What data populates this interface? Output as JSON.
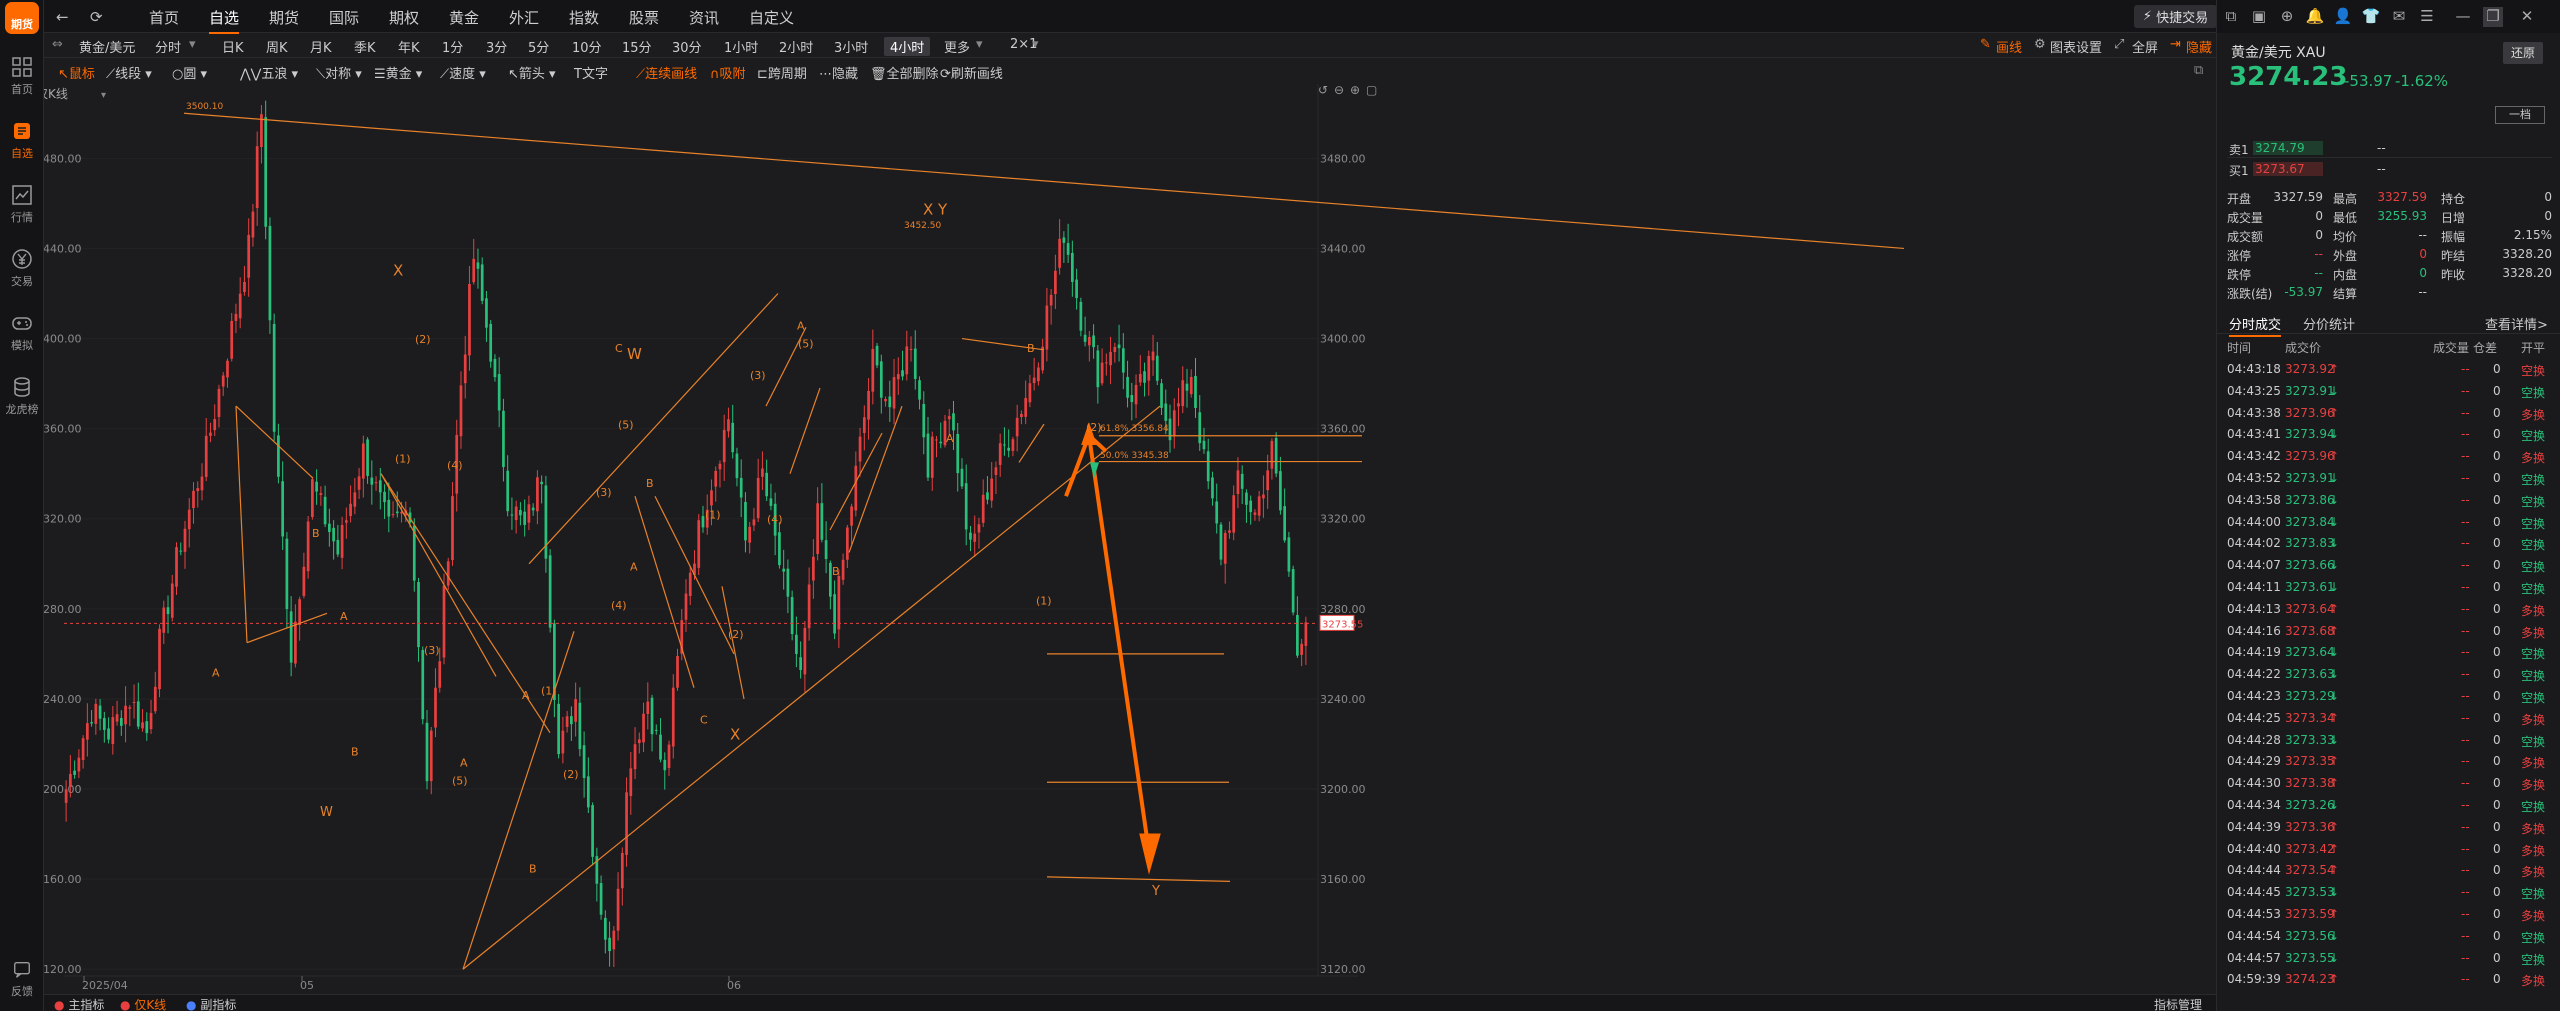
{
  "sidebar": {
    "logo": "期货",
    "items": [
      {
        "label": "首页",
        "icon": "grid-icon"
      },
      {
        "label": "自选",
        "icon": "star-icon",
        "active": true
      },
      {
        "label": "行情",
        "icon": "chart-icon"
      },
      {
        "label": "交易",
        "icon": "yen-icon"
      },
      {
        "label": "模拟",
        "icon": "gamepad-icon"
      },
      {
        "label": "龙虎榜",
        "icon": "database-icon"
      }
    ],
    "feedback": "反馈"
  },
  "topnav": {
    "menu": [
      "首页",
      "自选",
      "期货",
      "国际",
      "期权",
      "黄金",
      "外汇",
      "指数",
      "股票",
      "资讯",
      "自定义"
    ],
    "active": "自选",
    "quick_trade": "快捷交易"
  },
  "toolbar1": {
    "symbol": "黄金/美元",
    "periods": [
      "分时",
      "日K",
      "周K",
      "月K",
      "季K",
      "年K",
      "1分",
      "3分",
      "5分",
      "10分",
      "15分",
      "30分",
      "1小时",
      "2小时",
      "3小时",
      "4小时",
      "更多",
      "2×1"
    ],
    "active_period": "4小时",
    "right": {
      "draw": "画线",
      "settings": "图表设置",
      "fullscreen": "全屏",
      "hide": "隐藏"
    }
  },
  "toolbar2": {
    "items": [
      "鼠标",
      "线段",
      "圆",
      "五浪",
      "对称",
      "黄金",
      "速度",
      "箭头",
      "文字",
      "连续画线",
      "吸附",
      "跨周期",
      "隐藏",
      "全部删除",
      "刷新画线"
    ]
  },
  "chart_label": "仅K线",
  "chart_data": {
    "type": "candlestick",
    "instrument": "XAU",
    "period": "4小时",
    "y_ticks": [
      3480,
      3440,
      3400,
      3360,
      3320,
      3280,
      3240,
      3200,
      3160,
      3120
    ],
    "y_tick_labels": [
      "3480.00",
      "3440.00",
      "3400.00",
      "3360.00",
      "3320.00",
      "3280.00",
      "3240.00",
      "3200.00",
      "3160.00",
      "3120.00"
    ],
    "ylim": [
      3117,
      3513
    ],
    "x_tick_labels": [
      "2025/04",
      "05",
      "06"
    ],
    "current_price_tag": "3273.55",
    "high_label": "3500.10",
    "peak2_label": "3452.50",
    "fib_labels": [
      "61.8% 3356.84",
      "50.0% 3345.38"
    ],
    "anchors": [
      {
        "i": 0,
        "p": 3200
      },
      {
        "i": 6,
        "p": 3235
      },
      {
        "i": 10,
        "p": 3225
      },
      {
        "i": 15,
        "p": 3240
      },
      {
        "i": 19,
        "p": 3225
      },
      {
        "i": 22,
        "p": 3265
      },
      {
        "i": 27,
        "p": 3310
      },
      {
        "i": 33,
        "p": 3350
      },
      {
        "i": 38,
        "p": 3395
      },
      {
        "i": 43,
        "p": 3440
      },
      {
        "i": 46,
        "p": 3500
      },
      {
        "i": 49,
        "p": 3360
      },
      {
        "i": 53,
        "p": 3260
      },
      {
        "i": 58,
        "p": 3335
      },
      {
        "i": 64,
        "p": 3305
      },
      {
        "i": 70,
        "p": 3350
      },
      {
        "i": 76,
        "p": 3315
      },
      {
        "i": 81,
        "p": 3325
      },
      {
        "i": 85,
        "p": 3205
      },
      {
        "i": 88,
        "p": 3260
      },
      {
        "i": 93,
        "p": 3380
      },
      {
        "i": 96,
        "p": 3436
      },
      {
        "i": 100,
        "p": 3395
      },
      {
        "i": 104,
        "p": 3330
      },
      {
        "i": 108,
        "p": 3315
      },
      {
        "i": 112,
        "p": 3340
      },
      {
        "i": 116,
        "p": 3215
      },
      {
        "i": 120,
        "p": 3240
      },
      {
        "i": 125,
        "p": 3160
      },
      {
        "i": 128,
        "p": 3124
      },
      {
        "i": 133,
        "p": 3215
      },
      {
        "i": 137,
        "p": 3240
      },
      {
        "i": 141,
        "p": 3205
      },
      {
        "i": 146,
        "p": 3290
      },
      {
        "i": 151,
        "p": 3330
      },
      {
        "i": 156,
        "p": 3365
      },
      {
        "i": 160,
        "p": 3310
      },
      {
        "i": 164,
        "p": 3340
      },
      {
        "i": 168,
        "p": 3300
      },
      {
        "i": 173,
        "p": 3250
      },
      {
        "i": 177,
        "p": 3320
      },
      {
        "i": 181,
        "p": 3275
      },
      {
        "i": 186,
        "p": 3340
      },
      {
        "i": 190,
        "p": 3390
      },
      {
        "i": 194,
        "p": 3370
      },
      {
        "i": 199,
        "p": 3400
      },
      {
        "i": 203,
        "p": 3345
      },
      {
        "i": 208,
        "p": 3370
      },
      {
        "i": 213,
        "p": 3305
      },
      {
        "i": 218,
        "p": 3340
      },
      {
        "i": 223,
        "p": 3360
      },
      {
        "i": 228,
        "p": 3385
      },
      {
        "i": 232,
        "p": 3420
      },
      {
        "i": 235,
        "p": 3448
      },
      {
        "i": 239,
        "p": 3410
      },
      {
        "i": 243,
        "p": 3385
      },
      {
        "i": 247,
        "p": 3400
      },
      {
        "i": 251,
        "p": 3370
      },
      {
        "i": 256,
        "p": 3390
      },
      {
        "i": 260,
        "p": 3360
      },
      {
        "i": 265,
        "p": 3385
      },
      {
        "i": 268,
        "p": 3345
      },
      {
        "i": 272,
        "p": 3305
      },
      {
        "i": 276,
        "p": 3335
      },
      {
        "i": 280,
        "p": 3322
      },
      {
        "i": 284,
        "p": 3350
      },
      {
        "i": 287,
        "p": 3310
      },
      {
        "i": 290,
        "p": 3265
      },
      {
        "i": 292,
        "p": 3274
      }
    ],
    "wave_labels": [
      "3500.10",
      "A",
      "B",
      "A",
      "B",
      "W",
      "X",
      "(1)",
      "(2)",
      "(3)",
      "(4)",
      "(5)",
      "A",
      "B",
      "A",
      "(1)",
      "(2)",
      "(3)",
      "(4)",
      "(5)",
      "W",
      "C",
      "A",
      "B",
      "(1)",
      "(2)",
      "C",
      "X",
      "(3)",
      "(4)",
      "(5)",
      "A",
      "B",
      "X Y",
      "A",
      "B",
      "(1)",
      "(2)",
      "Y"
    ]
  },
  "bottom": {
    "main": "主指标",
    "kline": "仅K线",
    "sub": "副指标",
    "manage": "指标管理"
  },
  "panel": {
    "name": "黄金/美元  XAU",
    "price": "3274.23",
    "change": "-53.97",
    "change_pct": "-1.62%",
    "restore": "还原",
    "one_level": "一档",
    "sell1": {
      "label": "卖1",
      "price": "3274.79",
      "vol": "--"
    },
    "buy1": {
      "label": "买1",
      "price": "3273.67",
      "vol": "--"
    },
    "stats": [
      [
        "开盘",
        "3327.59",
        "最高",
        "3327.59",
        "持仓",
        "0"
      ],
      [
        "成交量",
        "0",
        "最低",
        "3255.93",
        "日增",
        "0"
      ],
      [
        "成交额",
        "0",
        "均价",
        "--",
        "振幅",
        "2.15%"
      ],
      [
        "涨停",
        "--",
        "外盘",
        "0",
        "昨结",
        "3328.20"
      ],
      [
        "跌停",
        "--",
        "内盘",
        "0",
        "昨收",
        "3328.20"
      ],
      [
        "涨跌(结)",
        "-53.97",
        "结算",
        "--",
        "",
        ""
      ]
    ],
    "tabs": [
      "分时成交",
      "分价统计"
    ],
    "detail_link": "查看详情>",
    "tick_headers": [
      "时间",
      "成交价",
      "成交量",
      "仓差",
      "开平"
    ],
    "ticks": [
      [
        "04:43:18",
        "3273.92",
        "up",
        "空换"
      ],
      [
        "04:43:25",
        "3273.91",
        "dn",
        "空换"
      ],
      [
        "04:43:38",
        "3273.96",
        "up",
        "多换"
      ],
      [
        "04:43:41",
        "3273.94",
        "dn",
        "空换"
      ],
      [
        "04:43:42",
        "3273.96",
        "up",
        "多换"
      ],
      [
        "04:43:52",
        "3273.91",
        "dn",
        "空换"
      ],
      [
        "04:43:58",
        "3273.86",
        "dn",
        "空换"
      ],
      [
        "04:44:00",
        "3273.84",
        "dn",
        "空换"
      ],
      [
        "04:44:02",
        "3273.83",
        "dn",
        "空换"
      ],
      [
        "04:44:07",
        "3273.66",
        "dn",
        "空换"
      ],
      [
        "04:44:11",
        "3273.61",
        "dn",
        "空换"
      ],
      [
        "04:44:13",
        "3273.64",
        "up",
        "多换"
      ],
      [
        "04:44:16",
        "3273.68",
        "up",
        "多换"
      ],
      [
        "04:44:19",
        "3273.64",
        "dn",
        "空换"
      ],
      [
        "04:44:22",
        "3273.63",
        "dn",
        "空换"
      ],
      [
        "04:44:23",
        "3273.29",
        "dn",
        "空换"
      ],
      [
        "04:44:25",
        "3273.34",
        "up",
        "多换"
      ],
      [
        "04:44:28",
        "3273.33",
        "dn",
        "空换"
      ],
      [
        "04:44:29",
        "3273.35",
        "up",
        "多换"
      ],
      [
        "04:44:30",
        "3273.38",
        "up",
        "多换"
      ],
      [
        "04:44:34",
        "3273.26",
        "dn",
        "空换"
      ],
      [
        "04:44:39",
        "3273.36",
        "up",
        "多换"
      ],
      [
        "04:44:40",
        "3273.42",
        "up",
        "多换"
      ],
      [
        "04:44:44",
        "3273.54",
        "up",
        "多换"
      ],
      [
        "04:44:45",
        "3273.53",
        "dn",
        "空换"
      ],
      [
        "04:44:53",
        "3273.59",
        "up",
        "多换"
      ],
      [
        "04:44:54",
        "3273.56",
        "dn",
        "空换"
      ],
      [
        "04:44:57",
        "3273.55",
        "dn",
        "空换"
      ],
      [
        "04:59:39",
        "3274.23",
        "up",
        "多换"
      ]
    ]
  },
  "colors": {
    "up": "#e84040",
    "down": "#28c07a",
    "accent": "#ff6a00",
    "wave": "#e8822a"
  }
}
